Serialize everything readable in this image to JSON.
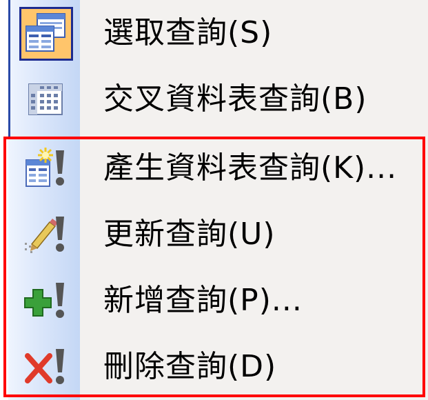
{
  "menu": {
    "items": [
      {
        "label": "選取查詢(S)",
        "icon": "select-query-icon"
      },
      {
        "label": "交叉資料表查詢(B)",
        "icon": "crosstab-query-icon"
      },
      {
        "label": "產生資料表查詢(K)...",
        "icon": "make-table-query-icon"
      },
      {
        "label": "更新查詢(U)",
        "icon": "update-query-icon"
      },
      {
        "label": "新增查詢(P)...",
        "icon": "append-query-icon"
      },
      {
        "label": "刪除查詢(D)",
        "icon": "delete-query-icon"
      }
    ]
  },
  "colors": {
    "highlight_box": "#ff0000",
    "selected_icon_bg": "#ffc56b",
    "selected_icon_border": "#1b2a8f"
  }
}
